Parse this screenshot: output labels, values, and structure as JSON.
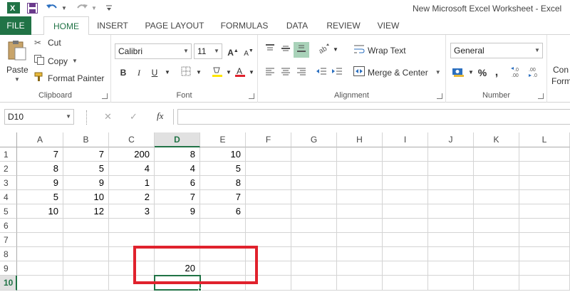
{
  "window": {
    "title": "New Microsoft Excel Worksheet - Excel"
  },
  "tabs": [
    "FILE",
    "HOME",
    "INSERT",
    "PAGE LAYOUT",
    "FORMULAS",
    "DATA",
    "REVIEW",
    "VIEW"
  ],
  "active_tab": "HOME",
  "ribbon": {
    "clipboard": {
      "paste_label": "Paste",
      "cut_label": "Cut",
      "copy_label": "Copy",
      "format_painter_label": "Format Painter",
      "group_label": "Clipboard"
    },
    "font": {
      "font_name": "Calibri",
      "font_size": "11",
      "bold": "B",
      "italic": "I",
      "underline": "U",
      "group_label": "Font"
    },
    "alignment": {
      "wrap_text_label": "Wrap Text",
      "merge_center_label": "Merge & Center",
      "group_label": "Alignment"
    },
    "number": {
      "format": "General",
      "percent": "%",
      "comma": ",",
      "group_label": "Number"
    },
    "styles": {
      "conditional_partial": "Con",
      "format_partial": "Form"
    }
  },
  "formula_bar": {
    "name_box": "D10",
    "formula": "",
    "cancel_glyph": "✕",
    "enter_glyph": "✓",
    "fx_glyph": "fx"
  },
  "sheet": {
    "columns": [
      "A",
      "B",
      "C",
      "D",
      "E",
      "F",
      "G",
      "H",
      "I",
      "J",
      "K",
      "L"
    ],
    "selected_column": "D",
    "rows": [
      "1",
      "2",
      "3",
      "4",
      "5",
      "6",
      "7",
      "8",
      "9",
      "10"
    ],
    "selected_row": "10",
    "cells": [
      [
        "7",
        "7",
        "200",
        "8",
        "10"
      ],
      [
        "8",
        "5",
        "4",
        "4",
        "5"
      ],
      [
        "9",
        "9",
        "1",
        "6",
        "8"
      ],
      [
        "5",
        "10",
        "2",
        "7",
        "7"
      ],
      [
        "10",
        "12",
        "3",
        "9",
        "6"
      ],
      [
        "",
        "",
        "",
        "",
        ""
      ],
      [
        "",
        "",
        "",
        "",
        ""
      ],
      [
        "",
        "",
        "",
        "",
        ""
      ],
      [
        "",
        "",
        "",
        "20",
        ""
      ],
      [
        "",
        "",
        "",
        "",
        ""
      ]
    ]
  },
  "colors": {
    "excel_green": "#217346",
    "highlight_red": "#e0222d",
    "fill_yellow": "#ffe600",
    "font_red": "#e0222d"
  }
}
